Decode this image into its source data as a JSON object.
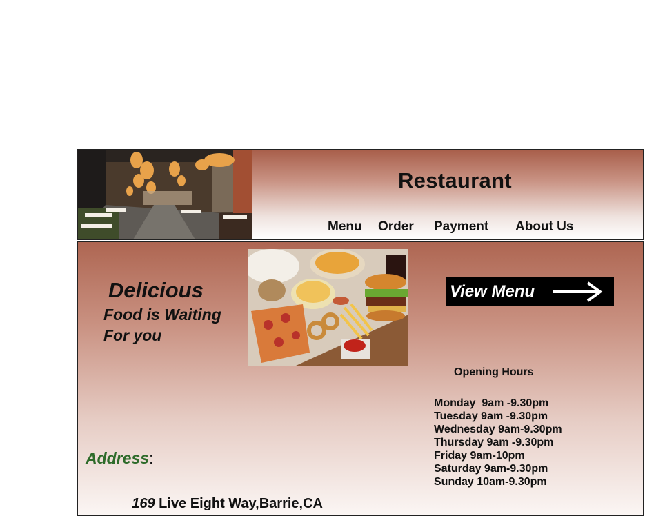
{
  "header": {
    "brand": "Restaurant",
    "nav": [
      "Menu",
      "Order",
      "Payment",
      "About Us"
    ]
  },
  "hero": {
    "tagline_big": "Delicious",
    "tagline_line1": "Food is Waiting",
    "tagline_line2": "For you"
  },
  "cta": {
    "label": "View Menu",
    "icon": "arrow-right-icon"
  },
  "hours": {
    "title": "Opening Hours",
    "rows": [
      "Monday  9am -9.30pm",
      "Tuesday 9am -9.30pm",
      "Wednesday 9am-9.30pm",
      "Thursday 9am -9.30pm",
      "Friday 9am-10pm",
      "Saturday 9am-9.30pm",
      "Sunday 10am-9.30pm"
    ]
  },
  "address": {
    "label": "Address",
    "colon": ":",
    "number": "169",
    "street": " Live Eight Way,Barrie,CA"
  },
  "colors": {
    "header_gradient_top": "#a85e4a",
    "address_label": "#2e6b2a",
    "cta_background": "#000000"
  }
}
